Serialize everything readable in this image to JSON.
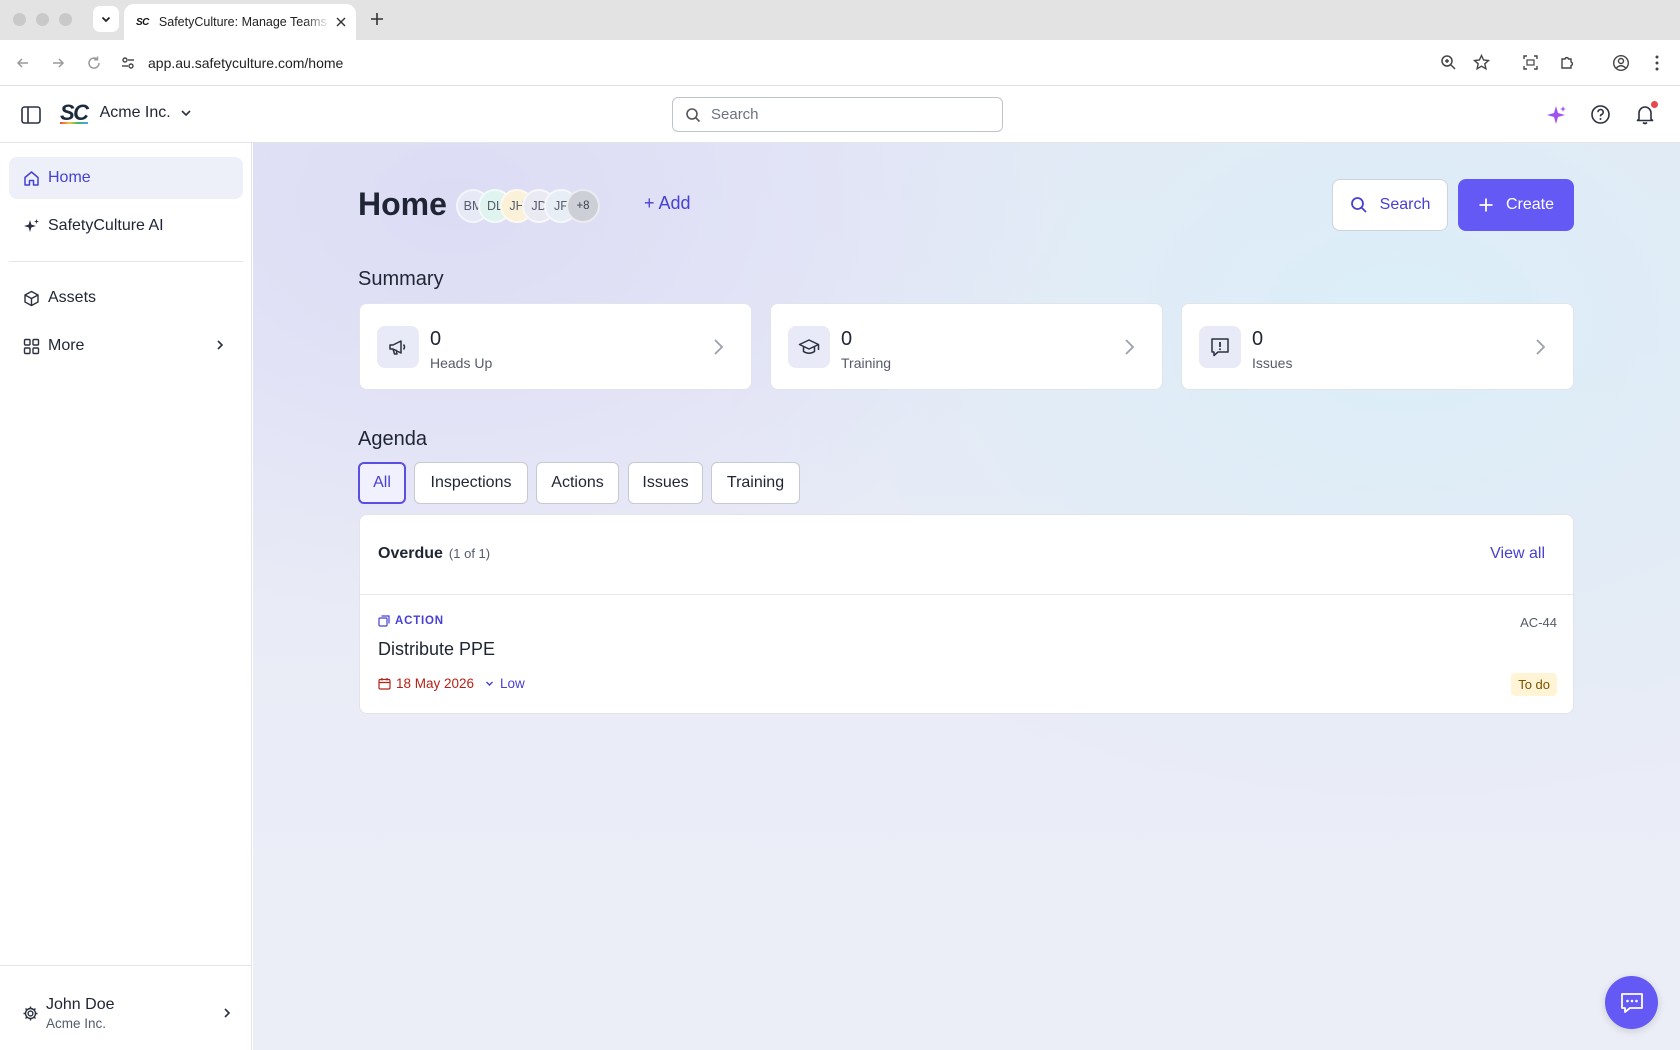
{
  "browser": {
    "tab_title": "SafetyCulture: Manage Teams and Inspections",
    "tab_favicon": "SC",
    "url": "app.au.safetyculture.com/home"
  },
  "header": {
    "org_logo": "SC",
    "org_name": "Acme Inc.",
    "search_placeholder": "Search"
  },
  "sidebar": {
    "items": [
      {
        "label": "Home",
        "icon": "home-icon"
      },
      {
        "label": "SafetyCulture AI",
        "icon": "sparkle-icon"
      },
      {
        "label": "Assets",
        "icon": "cube-icon"
      },
      {
        "label": "More",
        "icon": "grid-icon"
      }
    ],
    "user": {
      "name": "John Doe",
      "org": "Acme Inc."
    }
  },
  "main": {
    "title": "Home",
    "avatars": [
      "BM",
      "DL",
      "JH",
      "JD",
      "JF"
    ],
    "avatar_more": "+8",
    "add_label": "+ Add",
    "search_label": "Search",
    "create_label": "Create",
    "summary_heading": "Summary",
    "summary": [
      {
        "count": "0",
        "label": "Heads Up",
        "icon": "megaphone-icon"
      },
      {
        "count": "0",
        "label": "Training",
        "icon": "graduation-cap-icon"
      },
      {
        "count": "0",
        "label": "Issues",
        "icon": "alert-bubble-icon"
      }
    ],
    "agenda_heading": "Agenda",
    "filters": [
      "All",
      "Inspections",
      "Actions",
      "Issues",
      "Training"
    ],
    "overdue": {
      "title": "Overdue",
      "count": "(1 of 1)",
      "view_all": "View all",
      "item": {
        "type": "ACTION",
        "id": "AC-44",
        "title": "Distribute PPE",
        "due_date": "18 May 2026",
        "priority": "Low",
        "status": "To do"
      }
    }
  },
  "colors": {
    "accent": "#6559f5",
    "accent_text": "#4740d4",
    "overdue_red": "#b42318",
    "status_bg": "#fff4d6"
  }
}
